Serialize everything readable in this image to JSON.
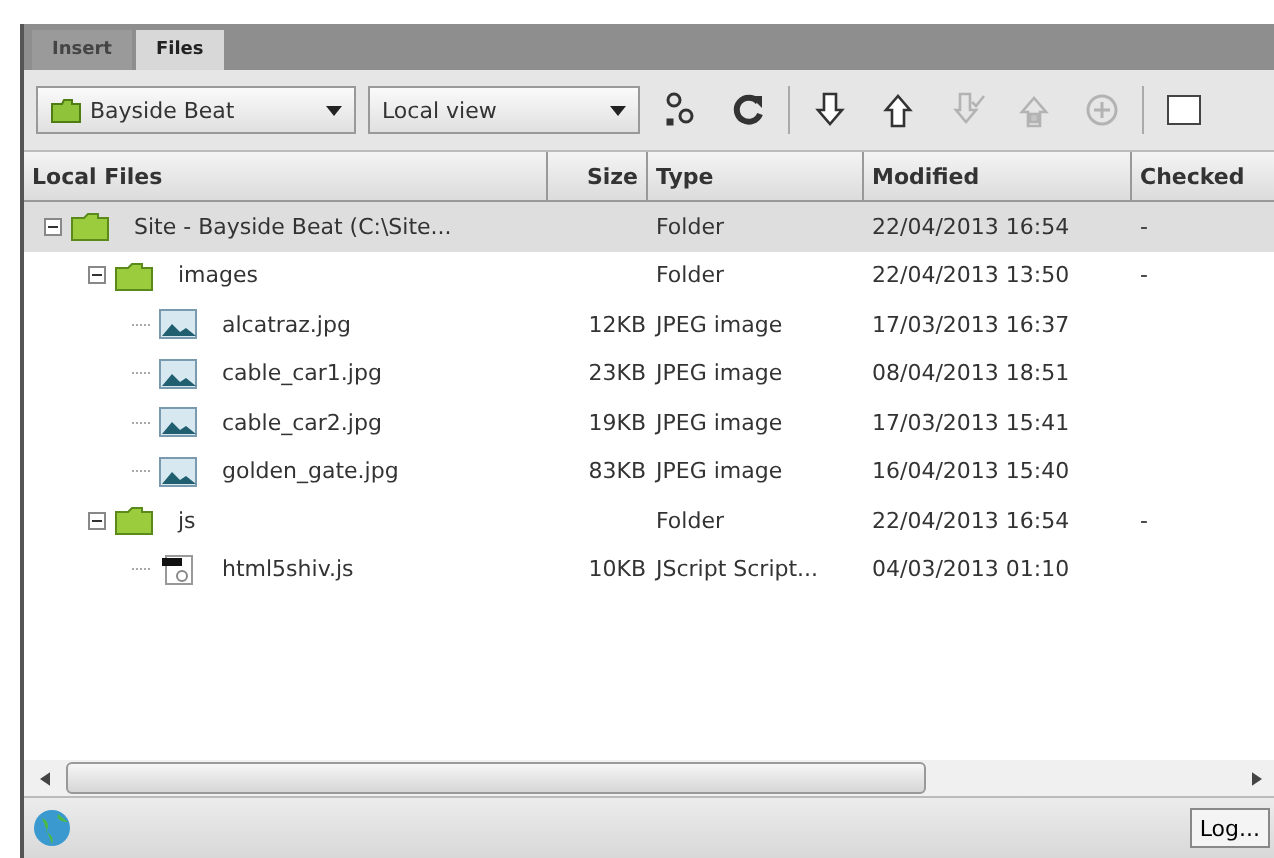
{
  "tabs": [
    {
      "label": "Insert",
      "selected": false
    },
    {
      "label": "Files",
      "selected": true
    }
  ],
  "toolbar": {
    "site": "Bayside Beat",
    "view": "Local view",
    "tools": [
      {
        "kind": "connect",
        "disabled": false
      },
      {
        "kind": "refresh",
        "disabled": false
      },
      {
        "kind": "get",
        "disabled": false
      },
      {
        "kind": "put",
        "disabled": false
      },
      {
        "kind": "checkout",
        "disabled": true
      },
      {
        "kind": "checkin",
        "disabled": true
      },
      {
        "kind": "sync",
        "disabled": true
      }
    ]
  },
  "columns": [
    "Local Files",
    "Size",
    "Type",
    "Modified",
    "Checked"
  ],
  "tree": [
    {
      "name": "Site - Bayside Beat (C:\\Site...",
      "type": "Folder",
      "modified": "22/04/2013 16:54",
      "checked": "-",
      "kind": "folder",
      "expanded": true,
      "selected": true,
      "children": [
        {
          "name": "images",
          "type": "Folder",
          "modified": "22/04/2013 13:50",
          "checked": "-",
          "kind": "folder",
          "expanded": true,
          "selected": false,
          "children": [
            {
              "name": "alcatraz.jpg",
              "size": "12KB",
              "type": "JPEG image",
              "modified": "17/03/2013 16:37",
              "kind": "image",
              "selected": false
            },
            {
              "name": "cable_car1.jpg",
              "size": "23KB",
              "type": "JPEG image",
              "modified": "08/04/2013 18:51",
              "kind": "image",
              "selected": false
            },
            {
              "name": "cable_car2.jpg",
              "size": "19KB",
              "type": "JPEG image",
              "modified": "17/03/2013 15:41",
              "kind": "image",
              "selected": false
            },
            {
              "name": "golden_gate.jpg",
              "size": "83KB",
              "type": "JPEG image",
              "modified": "16/04/2013 15:40",
              "kind": "image",
              "selected": false
            }
          ]
        },
        {
          "name": "js",
          "type": "Folder",
          "modified": "22/04/2013 16:54",
          "checked": "-",
          "kind": "folder",
          "expanded": true,
          "selected": false,
          "children": [
            {
              "name": "html5shiv.js",
              "size": "10KB",
              "type": "JScript Script...",
              "modified": "04/03/2013 01:10",
              "kind": "script",
              "selected": false
            }
          ]
        }
      ]
    }
  ],
  "status": {
    "log_button": "Log..."
  }
}
